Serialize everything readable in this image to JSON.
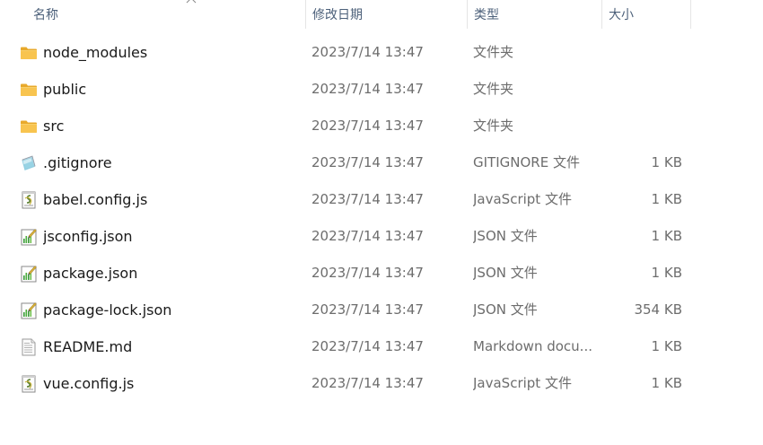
{
  "columns": {
    "name": "名称",
    "date": "修改日期",
    "type": "类型",
    "size": "大小"
  },
  "files": [
    {
      "name": "node_modules",
      "date": "2023/7/14 13:47",
      "type": "文件夹",
      "size": "",
      "icon": "folder-icon"
    },
    {
      "name": "public",
      "date": "2023/7/14 13:47",
      "type": "文件夹",
      "size": "",
      "icon": "folder-icon"
    },
    {
      "name": "src",
      "date": "2023/7/14 13:47",
      "type": "文件夹",
      "size": "",
      "icon": "folder-icon"
    },
    {
      "name": ".gitignore",
      "date": "2023/7/14 13:47",
      "type": "GITIGNORE 文件",
      "size": "1 KB",
      "icon": "gitignore-file-icon"
    },
    {
      "name": "babel.config.js",
      "date": "2023/7/14 13:47",
      "type": "JavaScript 文件",
      "size": "1 KB",
      "icon": "js-file-icon"
    },
    {
      "name": "jsconfig.json",
      "date": "2023/7/14 13:47",
      "type": "JSON 文件",
      "size": "1 KB",
      "icon": "json-file-icon"
    },
    {
      "name": "package.json",
      "date": "2023/7/14 13:47",
      "type": "JSON 文件",
      "size": "1 KB",
      "icon": "json-file-icon"
    },
    {
      "name": "package-lock.json",
      "date": "2023/7/14 13:47",
      "type": "JSON 文件",
      "size": "354 KB",
      "icon": "json-file-icon"
    },
    {
      "name": "README.md",
      "date": "2023/7/14 13:47",
      "type": "Markdown docu...",
      "size": "1 KB",
      "icon": "markdown-file-icon"
    },
    {
      "name": "vue.config.js",
      "date": "2023/7/14 13:47",
      "type": "JavaScript 文件",
      "size": "1 KB",
      "icon": "js-file-icon"
    }
  ],
  "colors": {
    "header_text": "#4c607a",
    "meta_text": "#6d6d6d",
    "folder": "#f8c44f"
  }
}
